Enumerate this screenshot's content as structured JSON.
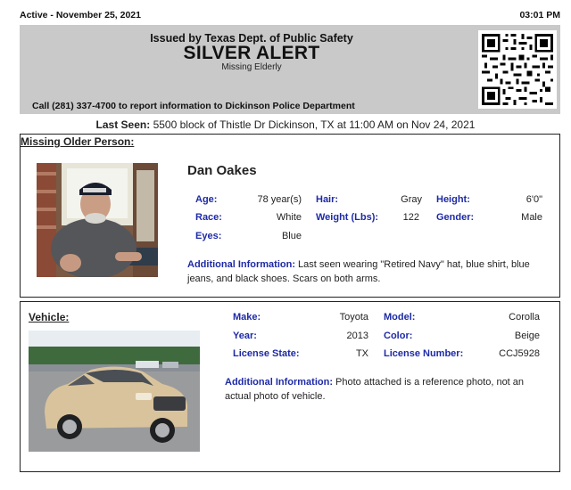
{
  "topbar": {
    "status": "Active - November 25, 2021",
    "time": "03:01 PM"
  },
  "banner": {
    "issued_by": "Issued by Texas Dept. of Public Safety",
    "title": "SILVER ALERT",
    "subtitle": "Missing Elderly",
    "call": "Call (281) 337-4700 to report information to Dickinson Police Department"
  },
  "last_seen": {
    "label": "Last Seen:",
    "text": "5500 block of Thistle Dr Dickinson, TX at 11:00 AM on Nov 24, 2021"
  },
  "person": {
    "section_title": "Missing Older Person:",
    "name": "Dan Oakes",
    "fields": {
      "age_label": "Age:",
      "age": "78 year(s)",
      "hair_label": "Hair:",
      "hair": "Gray",
      "height_label": "Height:",
      "height": "6'0\"",
      "race_label": "Race:",
      "race": "White",
      "weight_label": "Weight (Lbs):",
      "weight": "122",
      "gender_label": "Gender:",
      "gender": "Male",
      "eyes_label": "Eyes:",
      "eyes": "Blue"
    },
    "additional_label": "Additional Information:",
    "additional": "Last seen wearing \"Retired Navy\" hat, blue shirt, blue jeans, and black shoes. Scars on both arms."
  },
  "vehicle": {
    "section_title": "Vehicle:",
    "fields": {
      "make_label": "Make:",
      "make": "Toyota",
      "model_label": "Model:",
      "model": "Corolla",
      "year_label": "Year:",
      "year": "2013",
      "color_label": "Color:",
      "color": "Beige",
      "state_label": "License State:",
      "state": "TX",
      "plate_label": "License Number:",
      "plate": "CCJ5928"
    },
    "additional_label": "Additional Information:",
    "additional": "Photo attached is a reference photo, not an actual photo of vehicle."
  },
  "colors": {
    "label_blue": "#1e2aa6",
    "banner_gray": "#c9c9c9"
  }
}
